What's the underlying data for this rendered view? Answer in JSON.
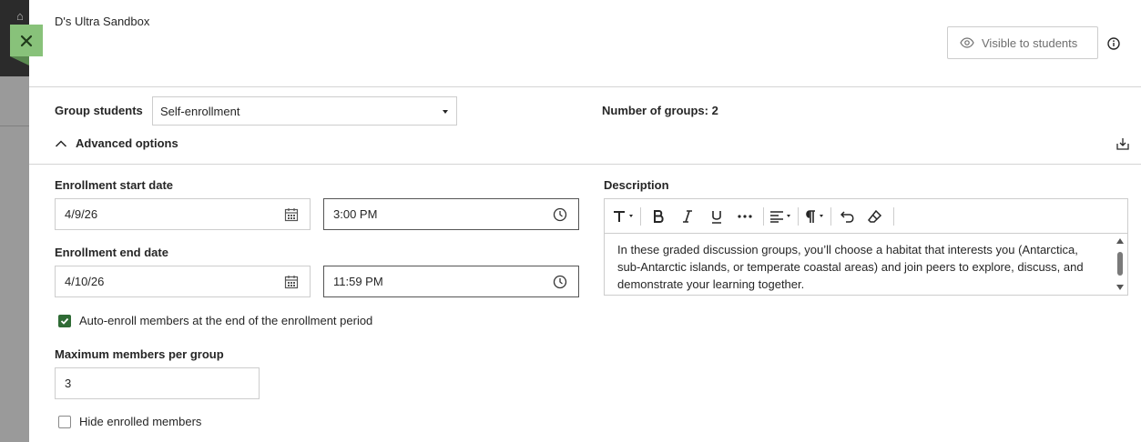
{
  "header": {
    "course_title": "D's Ultra Sandbox",
    "visibility_label": "Visible to students"
  },
  "grouping": {
    "group_students_label": "Group students",
    "group_students_value": "Self-enrollment",
    "number_of_groups_label": "Number of groups: 2"
  },
  "advanced": {
    "toggle_label": "Advanced options",
    "enrollment_start_label": "Enrollment start date",
    "enrollment_start_date": "4/9/26",
    "enrollment_start_time": "3:00 PM",
    "enrollment_end_label": "Enrollment end date",
    "enrollment_end_date": "4/10/26",
    "enrollment_end_time": "11:59 PM",
    "auto_enroll_label": "Auto-enroll members at the end of the enrollment period",
    "auto_enroll_checked": true,
    "max_members_label": "Maximum members per group",
    "max_members_value": "3",
    "hide_enrolled_label": "Hide enrolled members",
    "hide_enrolled_checked": false
  },
  "description": {
    "label": "Description",
    "text": "In these graded discussion groups, you’ll choose a habitat that interests you (Antarctica, sub-Antarctic islands, or temperate coastal areas) and join peers to explore, discuss, and demonstrate your learning together."
  },
  "icons": {
    "close": "close-icon",
    "eye": "eye-icon",
    "info": "info-icon",
    "chevron_up": "chevron-up-icon",
    "download": "download-icon",
    "calendar": "calendar-icon",
    "clock": "clock-icon"
  },
  "colors": {
    "close_button": "#88c27a",
    "checkbox_checked": "#2f6b35"
  }
}
